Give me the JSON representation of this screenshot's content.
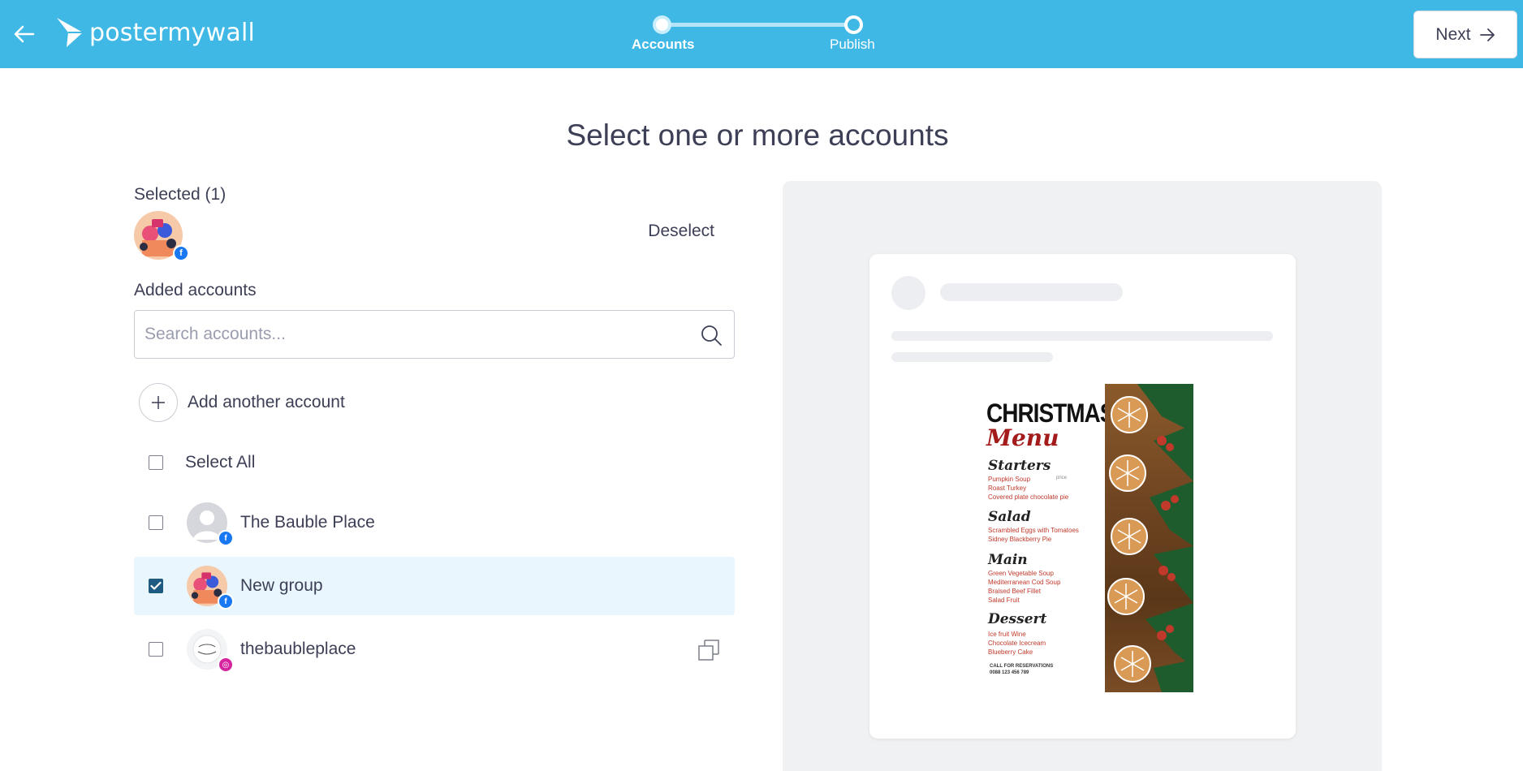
{
  "header": {
    "logo_text": "postermywall",
    "steps": [
      {
        "label": "Accounts",
        "active": true
      },
      {
        "label": "Publish",
        "active": false
      }
    ],
    "next_label": "Next"
  },
  "page_title": "Select one or more accounts",
  "selected": {
    "title": "Selected (1)",
    "deselect_label": "Deselect"
  },
  "added": {
    "title": "Added accounts",
    "search_placeholder": "Search accounts...",
    "add_another_label": "Add another account",
    "select_all_label": "Select All",
    "accounts": [
      {
        "name": "The Bauble Place",
        "network": "facebook",
        "checked": false
      },
      {
        "name": "New group",
        "network": "facebook",
        "checked": true
      },
      {
        "name": "thebaubleplace",
        "network": "instagram",
        "checked": false
      }
    ]
  },
  "preview": {
    "poster": {
      "title": "CHRISTMAS",
      "subtitle": "Menu",
      "sections": [
        {
          "name": "Starters",
          "items": [
            "Pumpkin Soup",
            "Roast Turkey",
            "Covered plate chocolate pie"
          ]
        },
        {
          "name": "Salad",
          "items": [
            "Scrambled Eggs with Tomatoes",
            "Sidney Blackberry Pie"
          ]
        },
        {
          "name": "Main",
          "items": [
            "Green Vegetable Soup",
            "Mediterranean Cod Soup",
            "Braised Beef Fillet",
            "Salad Fruit"
          ]
        },
        {
          "name": "Dessert",
          "items": [
            "Ice fruit Wine",
            "Chocolate Icecream",
            "Blueberry Cake"
          ]
        }
      ],
      "footer_line1": "CALL FOR RESERVATIONS",
      "footer_line2": "0088 123 456 789",
      "price_marker": "price"
    }
  },
  "colors": {
    "header_bg": "#40b8e6",
    "selected_row_bg": "#eaf6fd",
    "checkbox_checked": "#1f5a82",
    "facebook": "#1877f2",
    "instagram": "#d6249f",
    "preview_bg": "#f0f1f3"
  },
  "icons": {
    "back": "arrow-left-icon",
    "next": "arrow-right-icon",
    "search": "search-icon",
    "add": "plus-icon",
    "external": "open-external-icon",
    "facebook_badge": "facebook-icon",
    "instagram_badge": "instagram-icon"
  }
}
